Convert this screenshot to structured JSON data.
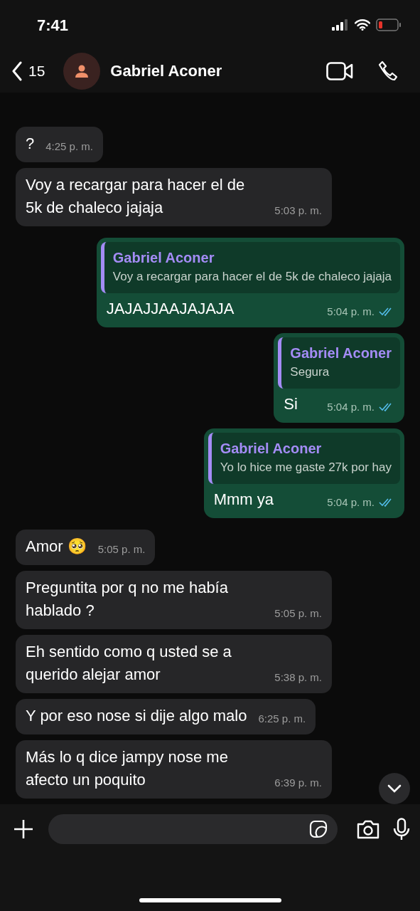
{
  "status_bar": {
    "time": "7:41"
  },
  "header": {
    "back_count": "15",
    "contact_name": "Gabriel Aconer"
  },
  "messages": [
    {
      "kind": "incoming",
      "text": "?",
      "time": "4:25 p. m."
    },
    {
      "kind": "incoming",
      "text": "Voy a recargar para hacer el de 5k de chaleco jajaja",
      "time": "5:03 p. m."
    },
    {
      "kind": "outgoing",
      "reply": {
        "author": "Gabriel Aconer",
        "text": "Voy a recargar para hacer el de 5k de chaleco jajaja"
      },
      "text": "JAJAJJAAJAJAJA",
      "time": "5:04 p. m.",
      "read": true
    },
    {
      "kind": "outgoing",
      "reply": {
        "author": "Gabriel Aconer",
        "text": "Segura"
      },
      "text": "Si",
      "time": "5:04 p. m.",
      "read": true
    },
    {
      "kind": "outgoing",
      "reply": {
        "author": "Gabriel Aconer",
        "text": "Yo lo hice me gaste 27k por hay"
      },
      "text": "Mmm ya",
      "time": "5:04 p. m.",
      "read": true
    },
    {
      "kind": "incoming",
      "text": "Amor 🥺",
      "time": "5:05 p. m."
    },
    {
      "kind": "incoming",
      "text": "Preguntita por q no me había hablado ?",
      "time": "5:05 p. m."
    },
    {
      "kind": "incoming",
      "text": "Eh sentido como q usted se a querido alejar amor",
      "time": "5:38 p. m."
    },
    {
      "kind": "incoming",
      "text": "Y por eso nose si dije algo malo",
      "time": "6:25 p. m."
    },
    {
      "kind": "incoming",
      "text": "Más lo q dice jampy nose me afecto un poquito",
      "time": "6:39 p. m."
    }
  ]
}
